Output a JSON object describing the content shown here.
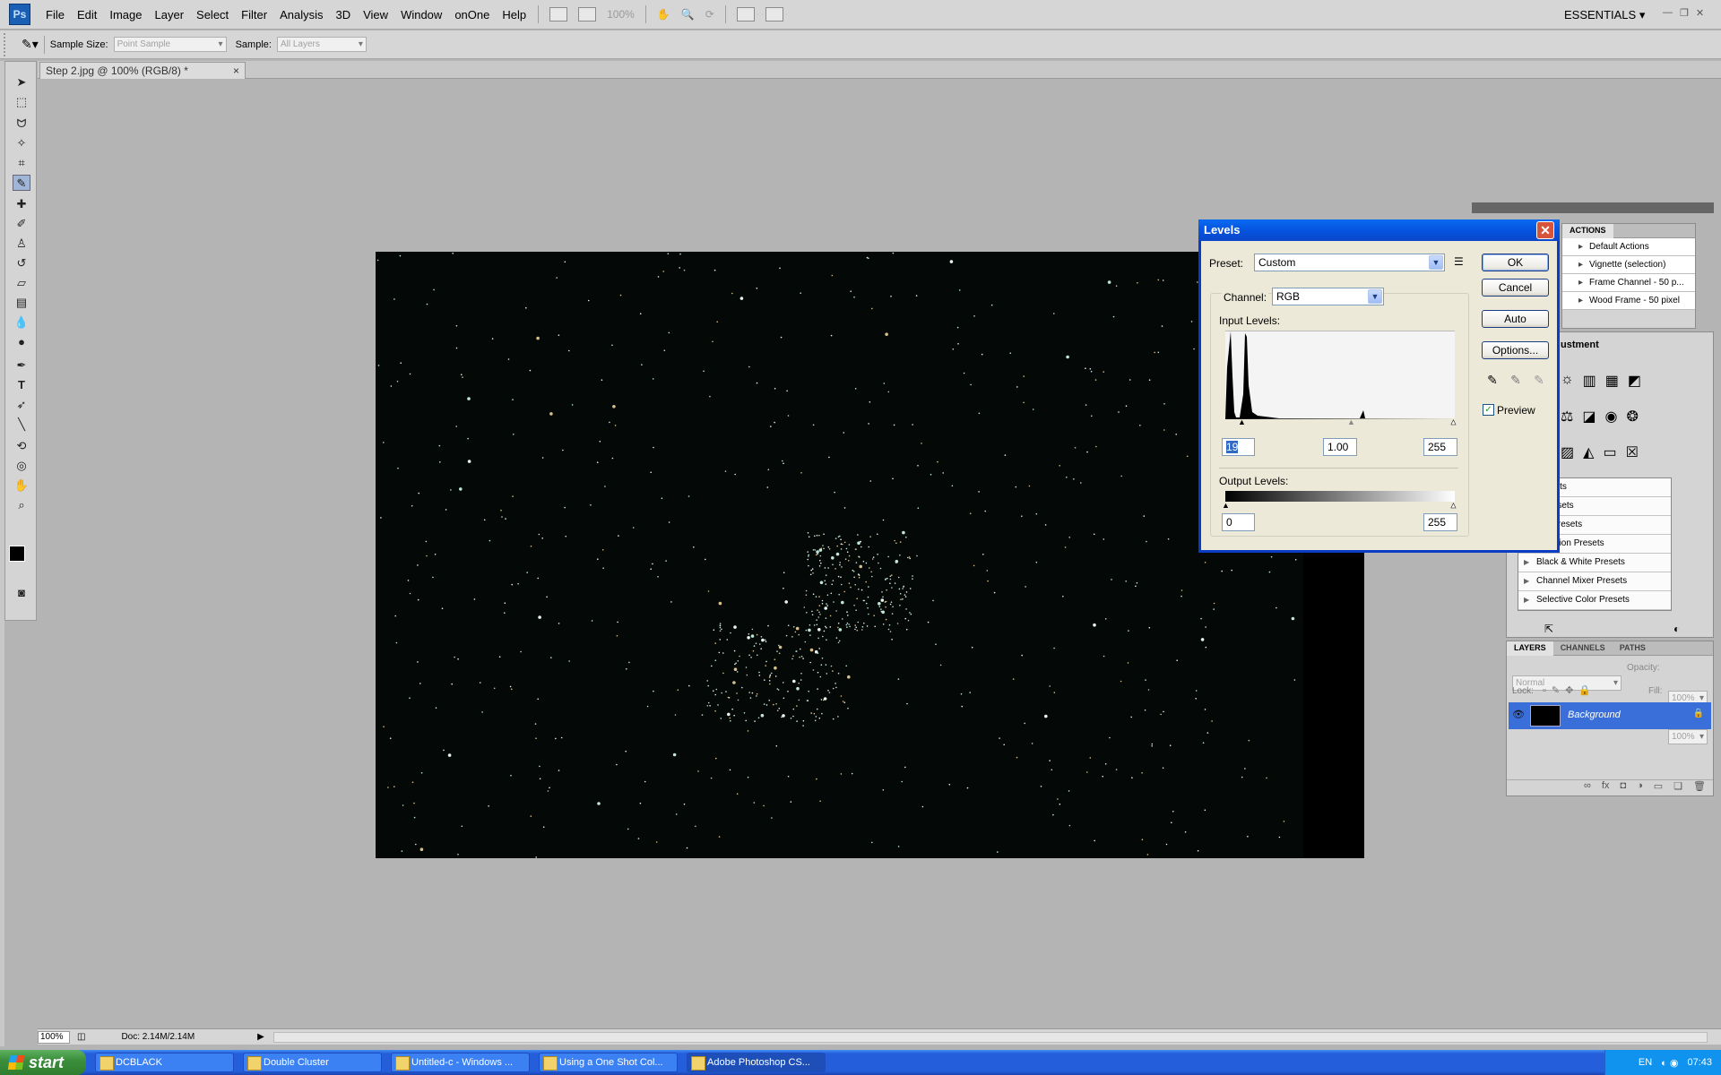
{
  "app": {
    "logo_text": "Ps",
    "menu": [
      "File",
      "Edit",
      "Image",
      "Layer",
      "Select",
      "Filter",
      "Analysis",
      "3D",
      "View",
      "Window",
      "onOne",
      "Help"
    ],
    "zoom_display": "100%",
    "workspace": "ESSENTIALS"
  },
  "options_bar": {
    "sample_size_label": "Sample Size:",
    "sample_size_value": "Point Sample",
    "sample_label": "Sample:",
    "sample_value": "All Layers"
  },
  "document": {
    "tab_title": "Step 2.jpg @ 100% (RGB/8) *",
    "tab_close": "×"
  },
  "status_bar": {
    "zoom": "100%",
    "doc_info": "Doc: 2.14M/2.14M"
  },
  "levels_dialog": {
    "title": "Levels",
    "preset_label": "Preset:",
    "preset_value": "Custom",
    "channel_label": "Channel:",
    "channel_value": "RGB",
    "input_levels_label": "Input Levels:",
    "input_black": "19",
    "input_gamma": "1.00",
    "input_white": "255",
    "output_levels_label": "Output Levels:",
    "output_black": "0",
    "output_white": "255",
    "ok_label": "OK",
    "cancel_label": "Cancel",
    "auto_label": "Auto",
    "options_label": "Options...",
    "preview_label": "Preview",
    "preview_checked": true
  },
  "actions_panel": {
    "tab": "ACTIONS",
    "items": [
      "Default Actions",
      "Vignette (selection)",
      "Frame Channel - 50 p...",
      "Wood Frame - 50 pixel"
    ]
  },
  "adjustments_panel": {
    "title_fragment": "ustment",
    "presets": [
      "Presets",
      "s Presets",
      "ure Presets",
      "aturation Presets",
      "Black & White Presets",
      "Channel Mixer Presets",
      "Selective Color Presets"
    ]
  },
  "layers_panel": {
    "tabs": [
      "LAYERS",
      "CHANNELS",
      "PATHS"
    ],
    "blend_mode": "Normal",
    "opacity_label": "Opacity:",
    "opacity_value": "100%",
    "lock_label": "Lock:",
    "fill_label": "Fill:",
    "fill_value": "100%",
    "layer_name": "Background"
  },
  "taskbar": {
    "start": "start",
    "items": [
      "DCBLACK",
      "Double Cluster",
      "Untitled-c - Windows ...",
      "Using a One Shot Col...",
      "Adobe Photoshop CS..."
    ],
    "active_index": 4,
    "lang": "EN",
    "clock": "07:43"
  }
}
